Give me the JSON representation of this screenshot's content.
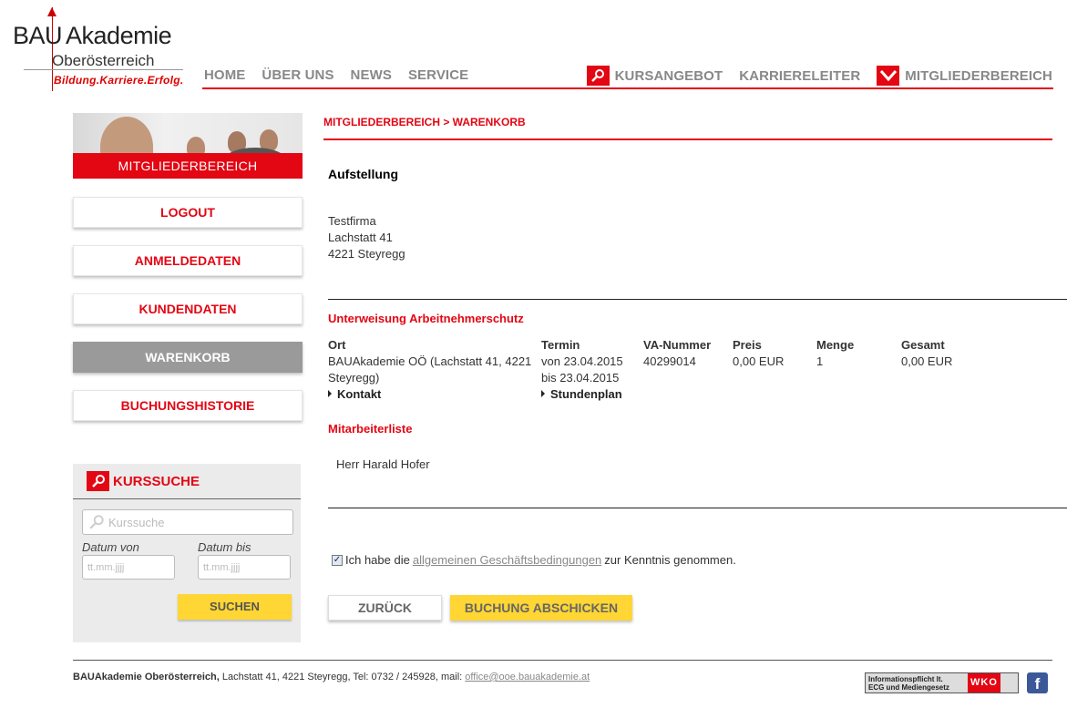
{
  "header": {
    "logo_bau": "BAU",
    "logo_akademie": "Akademie",
    "logo_region": "Oberösterreich",
    "logo_claim": "Bildung.Karriere.Erfolg.",
    "nav": [
      "HOME",
      "ÜBER UNS",
      "NEWS",
      "SERVICE"
    ],
    "kursangebot": "KURSANGEBOT",
    "karriereleiter": "KARRIERELEITER",
    "mitgliederbereich": "MITGLIEDERBEREICH"
  },
  "sidebar": {
    "banner_label": "MITGLIEDERBEREICH",
    "items": [
      "LOGOUT",
      "ANMELDEDATEN",
      "KUNDENDATEN",
      "WARENKORB",
      "BUCHUNGSHISTORIE"
    ],
    "active": "WARENKORB"
  },
  "kurssuche": {
    "title": "KURSSUCHE",
    "search_placeholder": "Kurssuche",
    "datum_von_label": "Datum von",
    "datum_bis_label": "Datum bis",
    "date_placeholder": "tt.mm.jjjj",
    "button": "SUCHEN"
  },
  "main": {
    "breadcrumb": "MITGLIEDERBEREICH > WARENKORB",
    "heading": "Aufstellung",
    "address": {
      "company": "Testfirma",
      "street": "Lachstatt 41",
      "city": "4221 Steyregg"
    },
    "course": {
      "title": "Unterweisung Arbeitnehmerschutz",
      "headers": {
        "ort": "Ort",
        "termin": "Termin",
        "va": "VA-Nummer",
        "preis": "Preis",
        "menge": "Menge",
        "gesamt": "Gesamt"
      },
      "ort_line1": "BAUAkademie OÖ (Lachstatt 41, 4221",
      "ort_line2": "Steyregg)",
      "termin_von": "von 23.04.2015",
      "termin_bis": "bis 23.04.2015",
      "va": "40299014",
      "preis": "0,00 EUR",
      "menge": "1",
      "gesamt": "0,00 EUR",
      "kontakt": "Kontakt",
      "stundenplan": "Stundenplan"
    },
    "mitarbeiter_title": "Mitarbeiterliste",
    "mitarbeiter": [
      "Herr Harald Hofer"
    ],
    "agb": {
      "checked": true,
      "prefix": "Ich habe die",
      "link": "allgemeinen Geschäftsbedingungen",
      "suffix": "zur Kenntnis genommen."
    },
    "btn_back": "ZURÜCK",
    "btn_submit": "BUCHUNG ABSCHICKEN"
  },
  "footer": {
    "org": "BAUAkademie Oberösterreich,",
    "address": "Lachstatt 41, 4221 Steyregg, Tel: 0732 / 245928, mail:",
    "email": "office@ooe.bauakademie.at",
    "wko_text1": "Informationspflicht lt.",
    "wko_text2": "ECG und Mediengesetz",
    "wko_logo": "WKO",
    "fb": "f"
  },
  "colors": {
    "accent": "#e30613",
    "button_yellow": "#ffd633",
    "active_gray": "#9a9a9a"
  }
}
